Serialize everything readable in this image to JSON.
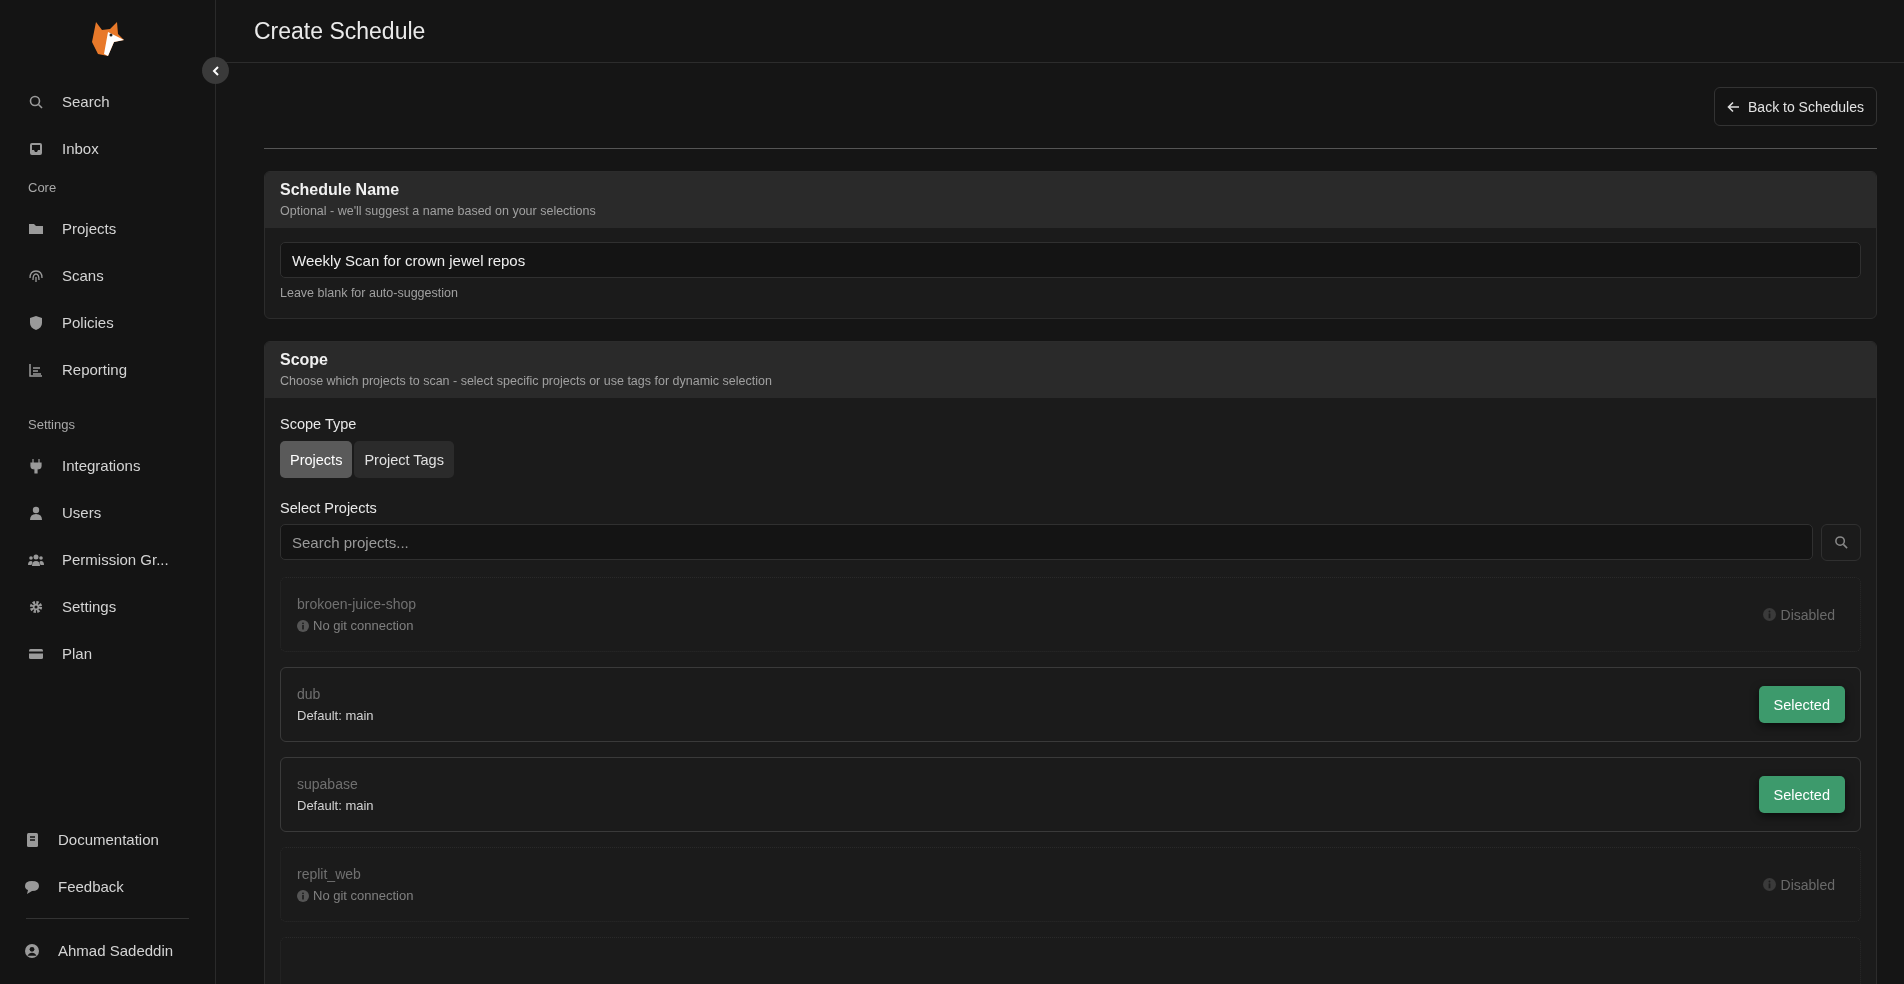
{
  "sidebar": {
    "top_items": [
      {
        "label": "Search",
        "selected": false
      },
      {
        "label": "Inbox",
        "selected": false
      }
    ],
    "sections": [
      {
        "heading": "Core",
        "items": [
          {
            "label": "Projects",
            "selected": false
          },
          {
            "label": "Scans",
            "selected": false
          },
          {
            "label": "Policies",
            "selected": false
          },
          {
            "label": "Reporting",
            "selected": false
          }
        ]
      },
      {
        "heading": "Settings",
        "items": [
          {
            "label": "Integrations",
            "selected": false
          },
          {
            "label": "Users",
            "selected": false
          },
          {
            "label": "Permission Gr...",
            "selected": false
          },
          {
            "label": "Settings",
            "selected": false
          },
          {
            "label": "Plan",
            "selected": false
          }
        ]
      }
    ],
    "bottom_items": [
      {
        "label": "Documentation"
      },
      {
        "label": "Feedback"
      }
    ],
    "user": "Ahmad Sadeddin"
  },
  "page": {
    "title": "Create Schedule",
    "back_button": "Back to Schedules"
  },
  "schedule_name": {
    "title": "Schedule Name",
    "subtitle": "Optional - we'll suggest a name based on your selections",
    "value": "Weekly Scan for crown jewel repos",
    "hint": "Leave blank for auto-suggestion"
  },
  "scope": {
    "title": "Scope",
    "subtitle": "Choose which projects to scan - select specific projects or use tags for dynamic selection",
    "type_label": "Scope Type",
    "types": [
      {
        "label": "Projects",
        "selected": true
      },
      {
        "label": "Project Tags",
        "selected": false
      }
    ],
    "select_label": "Select Projects",
    "search": {
      "placeholder": "Search projects..."
    },
    "projects": [
      {
        "name": "brokoen-juice-shop",
        "detail": "No git connection",
        "status": "Disabled",
        "disabled": true,
        "selected": false
      },
      {
        "name": "dub",
        "detail": "Default: main",
        "status": "Selected",
        "disabled": false,
        "selected": true
      },
      {
        "name": "supabase",
        "detail": "Default: main",
        "status": "Selected",
        "disabled": false,
        "selected": true
      },
      {
        "name": "replit_web",
        "detail": "No git connection",
        "status": "Disabled",
        "disabled": true,
        "selected": false
      }
    ]
  }
}
